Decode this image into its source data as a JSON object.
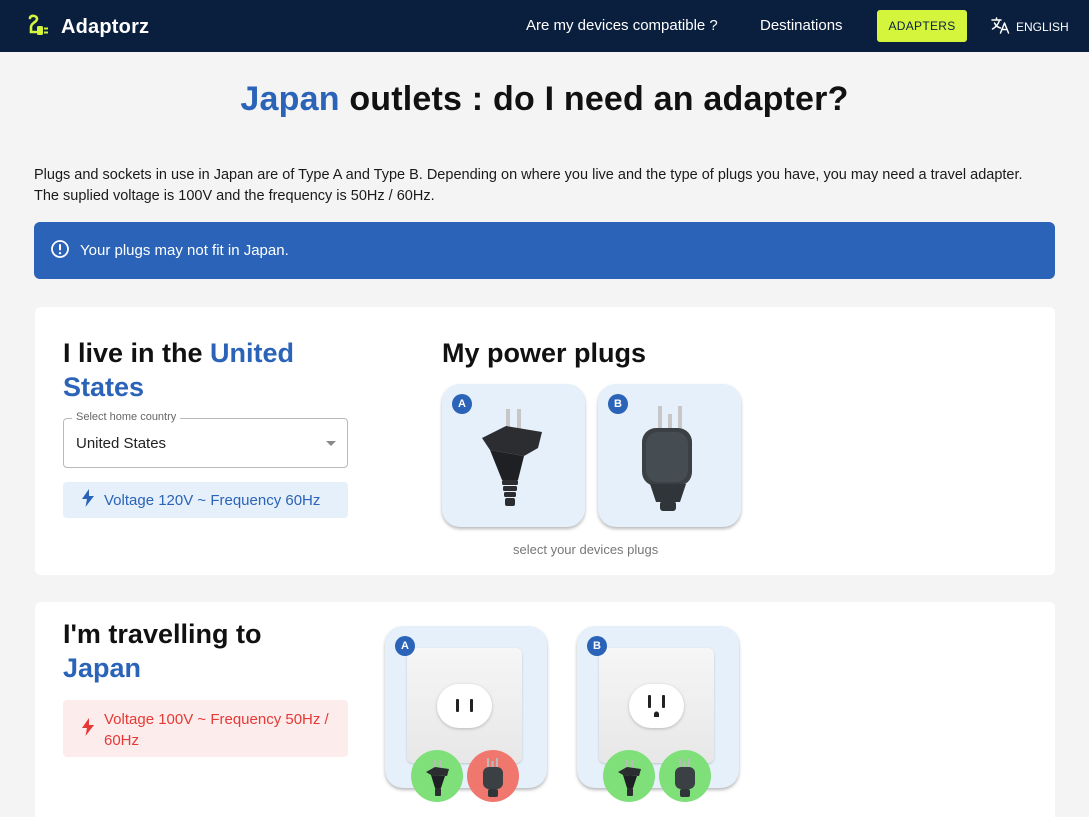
{
  "header": {
    "brand": "Adaptorz",
    "nav": {
      "compatible": "Are my devices compatible ?",
      "destinations": "Destinations",
      "adapters": "ADAPTERS",
      "language": "ENGLISH"
    }
  },
  "title": {
    "country": "Japan",
    "rest": " outlets : do I need an adapter?"
  },
  "intro": "Plugs and sockets in use in Japan are of Type A and Type B. Depending on where you live and the type of plugs you have, you may need a travel adapter. The suplied voltage is 100V and the frequency is 50Hz / 60Hz.",
  "alert": {
    "text": "Your plugs may not fit in Japan."
  },
  "home": {
    "heading_prefix": "I live in the ",
    "heading_country": "United States",
    "select_label": "Select home country",
    "select_value": "United States",
    "voltage": "Voltage 120V ~ Frequency 60Hz"
  },
  "plugs": {
    "heading": "My power plugs",
    "items": [
      {
        "type": "A"
      },
      {
        "type": "B"
      }
    ],
    "hint": "select your devices plugs"
  },
  "destination": {
    "heading_prefix": "I'm travelling to",
    "heading_country": "Japan",
    "voltage": "Voltage 100V ~ Frequency 50Hz / 60Hz",
    "outlets": [
      {
        "type": "A",
        "compat": [
          {
            "plug": "A",
            "ok": true
          },
          {
            "plug": "B",
            "ok": false
          }
        ]
      },
      {
        "type": "B",
        "compat": [
          {
            "plug": "A",
            "ok": true
          },
          {
            "plug": "B",
            "ok": true
          }
        ]
      }
    ]
  },
  "colors": {
    "navbar": "#0a1f3d",
    "accent_blue": "#2a63b8",
    "adapters_button": "#d4f53c",
    "compatible_green": "#7fe07a",
    "incompatible_red": "#f0776e",
    "warning_red": "#e53935"
  }
}
